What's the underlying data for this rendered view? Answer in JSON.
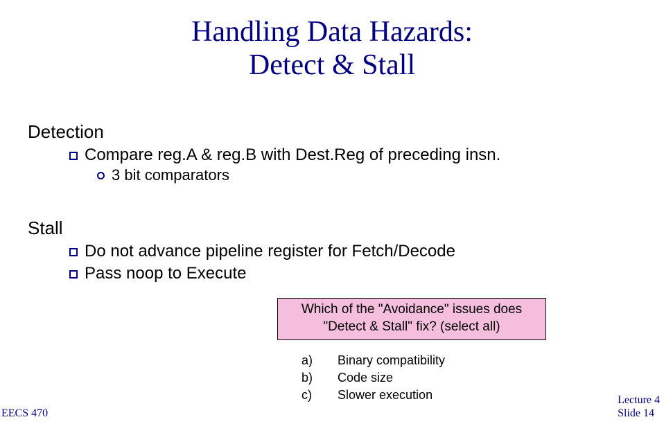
{
  "title_line1": "Handling Data Hazards:",
  "title_line2": "Detect & Stall",
  "detection_heading": "Detection",
  "detection_bullet": "Compare reg.A & reg.B with Dest.Reg of preceding insn.",
  "detection_sub": "3 bit comparators",
  "stall_heading": "Stall",
  "stall_bullet1": "Do not advance pipeline register for Fetch/Decode",
  "stall_bullet2": "Pass noop to Execute",
  "callout_line1": "Which of the \"Avoidance\" issues does",
  "callout_line2": "\"Detect & Stall\" fix? (select all)",
  "options": [
    {
      "letter": "a)",
      "text": "Binary compatibility"
    },
    {
      "letter": "b)",
      "text": "Code size"
    },
    {
      "letter": "c)",
      "text": "Slower execution"
    }
  ],
  "footer_left": "EECS 470",
  "footer_right_line1": "Lecture 4",
  "footer_right_line2": "Slide 14"
}
